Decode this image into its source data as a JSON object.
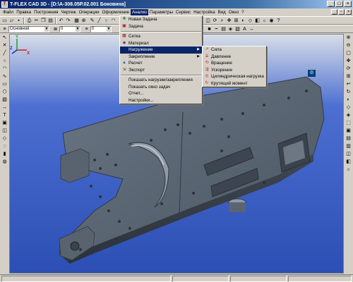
{
  "window": {
    "title": "T-FLEX CAD 3D - [D:\\A-308.05P.02.001 Боковина]",
    "app_icon": "t-flex-icon"
  },
  "menubar": {
    "items": [
      "Файл",
      "Правка",
      "Построения",
      "Чертеж",
      "Операции",
      "Оформление",
      "Анализ",
      "Параметры",
      "Сервис",
      "Настройка",
      "Вид",
      "Окно",
      "?"
    ],
    "active_index": 6
  },
  "toolbar": {
    "layer_combo": "Основной",
    "combo2": "0",
    "combo3": "0"
  },
  "analysis_menu": {
    "items": [
      {
        "label": "Новая Задача",
        "icon": "new-task-icon"
      },
      {
        "label": "Задача",
        "icon": "task-icon"
      },
      {
        "separator": true
      },
      {
        "label": "Сетка",
        "icon": "mesh-icon"
      },
      {
        "label": "Материал",
        "icon": "material-icon"
      },
      {
        "label": "Нагружение",
        "icon": "",
        "submenu": true,
        "highlighted": true
      },
      {
        "label": "Закрепление",
        "icon": "",
        "submenu": true
      },
      {
        "label": "Расчет",
        "icon": "calculate-icon"
      },
      {
        "label": "Экспорт",
        "icon": "export-icon"
      },
      {
        "separator": true
      },
      {
        "label": "Показать нагрузки/закрепления",
        "icon": ""
      },
      {
        "label": "Показать окно задач",
        "icon": ""
      },
      {
        "label": "Отчет...",
        "icon": ""
      },
      {
        "label": "Настройки...",
        "icon": ""
      }
    ]
  },
  "load_submenu": {
    "items": [
      {
        "label": "Сила",
        "icon": "force-icon"
      },
      {
        "label": "Давление",
        "icon": "pressure-icon"
      },
      {
        "label": "Вращение",
        "icon": "rotation-icon"
      },
      {
        "label": "Ускорение",
        "icon": "acceleration-icon"
      },
      {
        "label": "Цилиндрическая нагрузка",
        "icon": "cylindrical-load-icon"
      },
      {
        "label": "Крутящий момент",
        "icon": "torque-icon"
      }
    ]
  },
  "axes": {
    "x": "X",
    "y": "Y",
    "z": "Z"
  },
  "colors": {
    "title_bar": "#0a246a",
    "viewport_top": "#d8dee8",
    "viewport_bottom": "#2c4fb5",
    "part": "#4f5a66"
  }
}
